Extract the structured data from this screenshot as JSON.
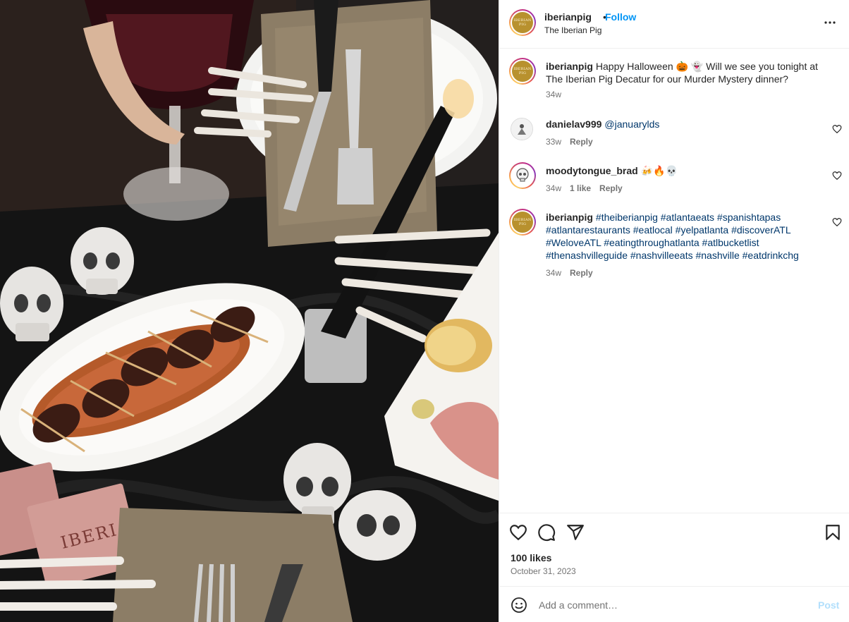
{
  "post": {
    "photo_box_text_1": "IBERIAN PIG",
    "photo_box_text_2": "IBERIAN",
    "avatar_logo_line1": "IBERIAN",
    "avatar_logo_line2": "PIG"
  },
  "header": {
    "username": "iberianpig",
    "dot": "•",
    "follow_label": "Follow",
    "subtitle": "The Iberian Pig",
    "more_icon": "more-horizontal-icon"
  },
  "caption": {
    "username": "iberianpig",
    "text": "Happy Halloween 🎃 👻 Will we see you tonight at The Iberian Pig Decatur for our Murder Mystery dinner?",
    "time": "34w"
  },
  "comments": [
    {
      "username": "danielav999",
      "text": "@januarylds",
      "time": "33w",
      "likes": "",
      "reply": "Reply"
    },
    {
      "username": "moodytongue_brad",
      "text": "🍻🔥💀",
      "time": "34w",
      "likes": "1 like",
      "reply": "Reply"
    },
    {
      "username": "iberianpig",
      "text": "#theiberianpig #atlantaeats #spanishtapas #atlantarestaurants #eatlocal #yelpatlanta #discoverATL #WeloveATL #eatingthroughatlanta #atlbucketlist #thenashvilleguide #nashvilleeats #nashville #eatdrinkchg",
      "time": "34w",
      "likes": "",
      "reply": "Reply"
    }
  ],
  "footer": {
    "likes": "100 likes",
    "date": "October 31, 2023",
    "add_comment_placeholder": "Add a comment…",
    "post_label": "Post"
  },
  "icons": {
    "like": "heart-icon",
    "comment": "comment-icon",
    "share": "share-icon",
    "save": "bookmark-icon",
    "emoji": "emoji-icon"
  },
  "colors": {
    "link": "#0095f6",
    "hashtag": "#00376b",
    "meta": "#737373",
    "post_disabled": "#b2dffc"
  }
}
